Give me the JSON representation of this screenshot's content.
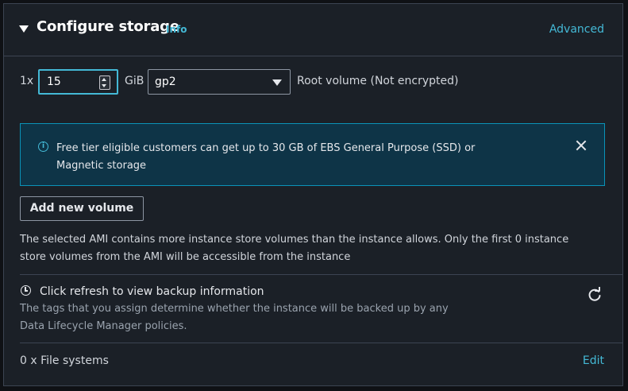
{
  "header": {
    "title": "Configure storage",
    "info_label": "Info",
    "advanced_label": "Advanced"
  },
  "volume": {
    "count_label": "1x",
    "size_value": "15",
    "unit": "GiB",
    "type_value": "gp2",
    "root_label": "Root volume  (Not encrypted)"
  },
  "alert": {
    "message": "Free tier eligible customers can get up to 30 GB of EBS General Purpose (SSD) or Magnetic storage"
  },
  "buttons": {
    "add_volume": "Add new volume"
  },
  "ami_note": "The selected AMI contains more instance store volumes than the instance allows. Only the first 0 instance store volumes from the AMI will be accessible from the instance",
  "backup": {
    "title": "Click refresh to view backup information",
    "description": "The tags that you assign determine whether the instance will be backed up by any Data Lifecycle Manager policies."
  },
  "file_systems": {
    "count_label": "0 x File systems",
    "edit_label": "Edit"
  },
  "icons": {
    "collapse": "caret-down-icon",
    "alert": "info-circle-icon",
    "dismiss": "close-icon",
    "backup": "clock-icon",
    "refresh": "refresh-icon"
  },
  "colors": {
    "accent": "#44b9d6",
    "panel_bg": "#1b2027",
    "alert_bg": "#0e3447",
    "alert_border": "#0a93b8"
  }
}
